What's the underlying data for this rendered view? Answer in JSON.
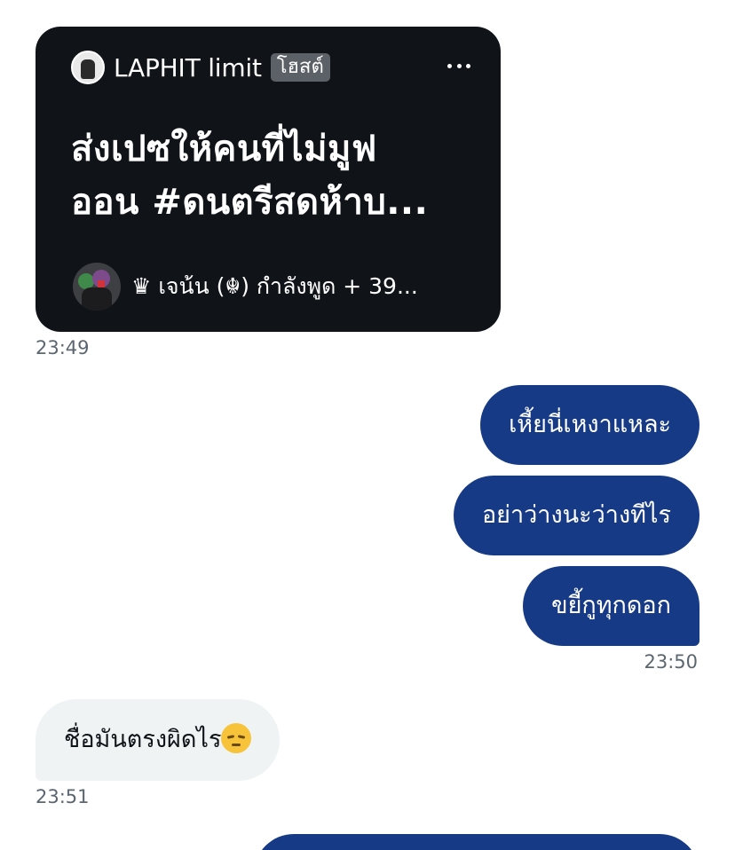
{
  "space_card": {
    "host_name": "LAPHIT limit",
    "host_badge": "โฮสต์",
    "title_line1": "ส่งเปซให้คนที่ไม่มูฟ",
    "title_line2": "ออน #ดนตรีสดห้าบ...",
    "speaker_text": "♛ เจน้น (☬) กำลังพูด + 39...",
    "more_icon": "more-horizontal-icon"
  },
  "messages": [
    {
      "direction": "in",
      "kind": "space-share",
      "time": "23:49"
    },
    {
      "direction": "out",
      "text": "เหี้ยนี่เหงาแหละ"
    },
    {
      "direction": "out",
      "text": "อย่าว่างนะว่างทีไร"
    },
    {
      "direction": "out",
      "text": "ขยี้กูทุกดอก",
      "time": "23:50"
    },
    {
      "direction": "in",
      "text": "ชื่อมันตรงผิดไร",
      "emoji": "pensive-face-icon",
      "time": "23:51"
    }
  ],
  "colors": {
    "outgoing_bubble": "#173a86",
    "incoming_bubble": "#eff3f4",
    "card_background": "#101318",
    "timestamp": "#5b6670"
  }
}
